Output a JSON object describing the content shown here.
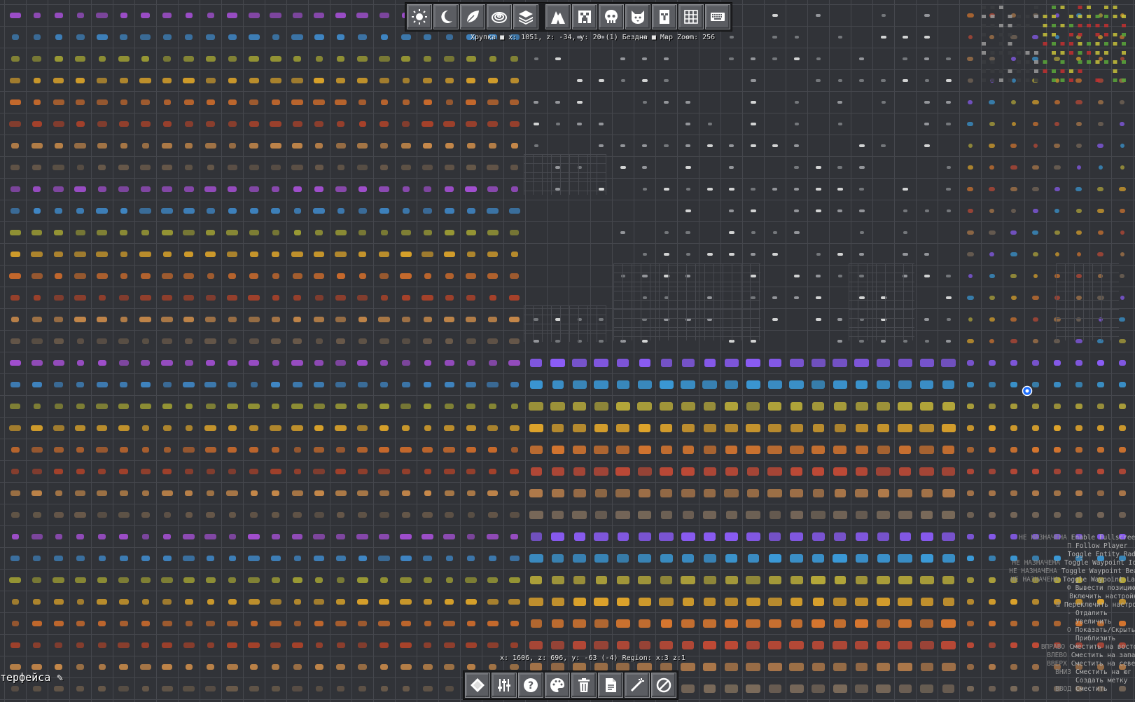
{
  "top_info": {
    "text": "Хрупка ■ x: 1051, z: -34, y: 20 (1) Бездна ■ Map Zoom: 256"
  },
  "bottom_info": {
    "text": "x: 1606, z: 696, y: -63 (-4)  Region: x:3 z:1"
  },
  "interface_label": {
    "text": "терфейса ✎"
  },
  "top_toolbar": {
    "buttons": [
      {
        "name": "day-mode",
        "icon": "sun-icon"
      },
      {
        "name": "night-mode",
        "icon": "moon-icon"
      },
      {
        "name": "biome-mode",
        "icon": "leaf-icon"
      },
      {
        "name": "topo-mode",
        "icon": "topography-icon"
      },
      {
        "name": "layers-mode",
        "icon": "layers-icon"
      },
      {
        "name": "caves-mode",
        "icon": "cave-icon"
      },
      {
        "name": "mobs-mode",
        "icon": "creeper-icon"
      },
      {
        "name": "players-mode",
        "icon": "skull-icon"
      },
      {
        "name": "pets-mode",
        "icon": "cat-icon"
      },
      {
        "name": "villagers-mode",
        "icon": "villager-icon"
      },
      {
        "name": "grid-toggle",
        "icon": "grid-icon"
      },
      {
        "name": "keybinds-toggle",
        "icon": "keyboard-icon"
      }
    ]
  },
  "bottom_toolbar": {
    "buttons": [
      {
        "name": "waypoint-create",
        "icon": "diamond-icon"
      },
      {
        "name": "settings",
        "icon": "sliders-icon"
      },
      {
        "name": "help",
        "icon": "help-icon"
      },
      {
        "name": "theme",
        "icon": "palette-icon"
      },
      {
        "name": "delete",
        "icon": "trash-icon"
      },
      {
        "name": "export",
        "icon": "document-icon"
      },
      {
        "name": "edit",
        "icon": "wand-icon"
      },
      {
        "name": "disable",
        "icon": "disabled-icon"
      }
    ]
  },
  "keybinds": [
    {
      "key": "НЕ НАЗНАЧЕНА",
      "action": "Enable Fullscreen"
    },
    {
      "key": "П",
      "action": "Follow Player"
    },
    {
      "key": "",
      "action": "Toggle Entity Radar"
    },
    {
      "key": "НЕ НАЗНАЧЕНА",
      "action": "Toggle Waypoint Icons"
    },
    {
      "key": "НЕ НАЗНАЧЕНА",
      "action": "Toggle Waypoint Beacons"
    },
    {
      "key": "НЕ НАЗНАЧЕНА",
      "action": "Toggle Waypoint Labels"
    },
    {
      "key": "Ф",
      "action": "Вывести позицию"
    },
    {
      "key": "",
      "action": "Включить настройки"
    },
    {
      "key": "Ш",
      "action": "Переключить настройки"
    },
    {
      "key": "-",
      "action": "Отдалить"
    },
    {
      "key": "",
      "action": "Увеличить"
    },
    {
      "key": "О",
      "action": "Показать/Скрыть"
    },
    {
      "key": "",
      "action": "Приблизить"
    },
    {
      "key": "ВПРАВО",
      "action": "Сместить на восток"
    },
    {
      "key": "ВЛЕВО",
      "action": "Сместить на запад"
    },
    {
      "key": "ВВЕРХ",
      "action": "Сместить на север"
    },
    {
      "key": "ВНИЗ",
      "action": "Сместить на юг"
    },
    {
      "key": "",
      "action": "Создать метку"
    },
    {
      "key": "ВВОД",
      "action": "Сместить"
    }
  ],
  "colors": {
    "background": "#313338",
    "grid": "#45474d",
    "toolbar_bg": "#1c1d20",
    "button": "#5b5d62",
    "waypoint": "#1e6fff"
  }
}
